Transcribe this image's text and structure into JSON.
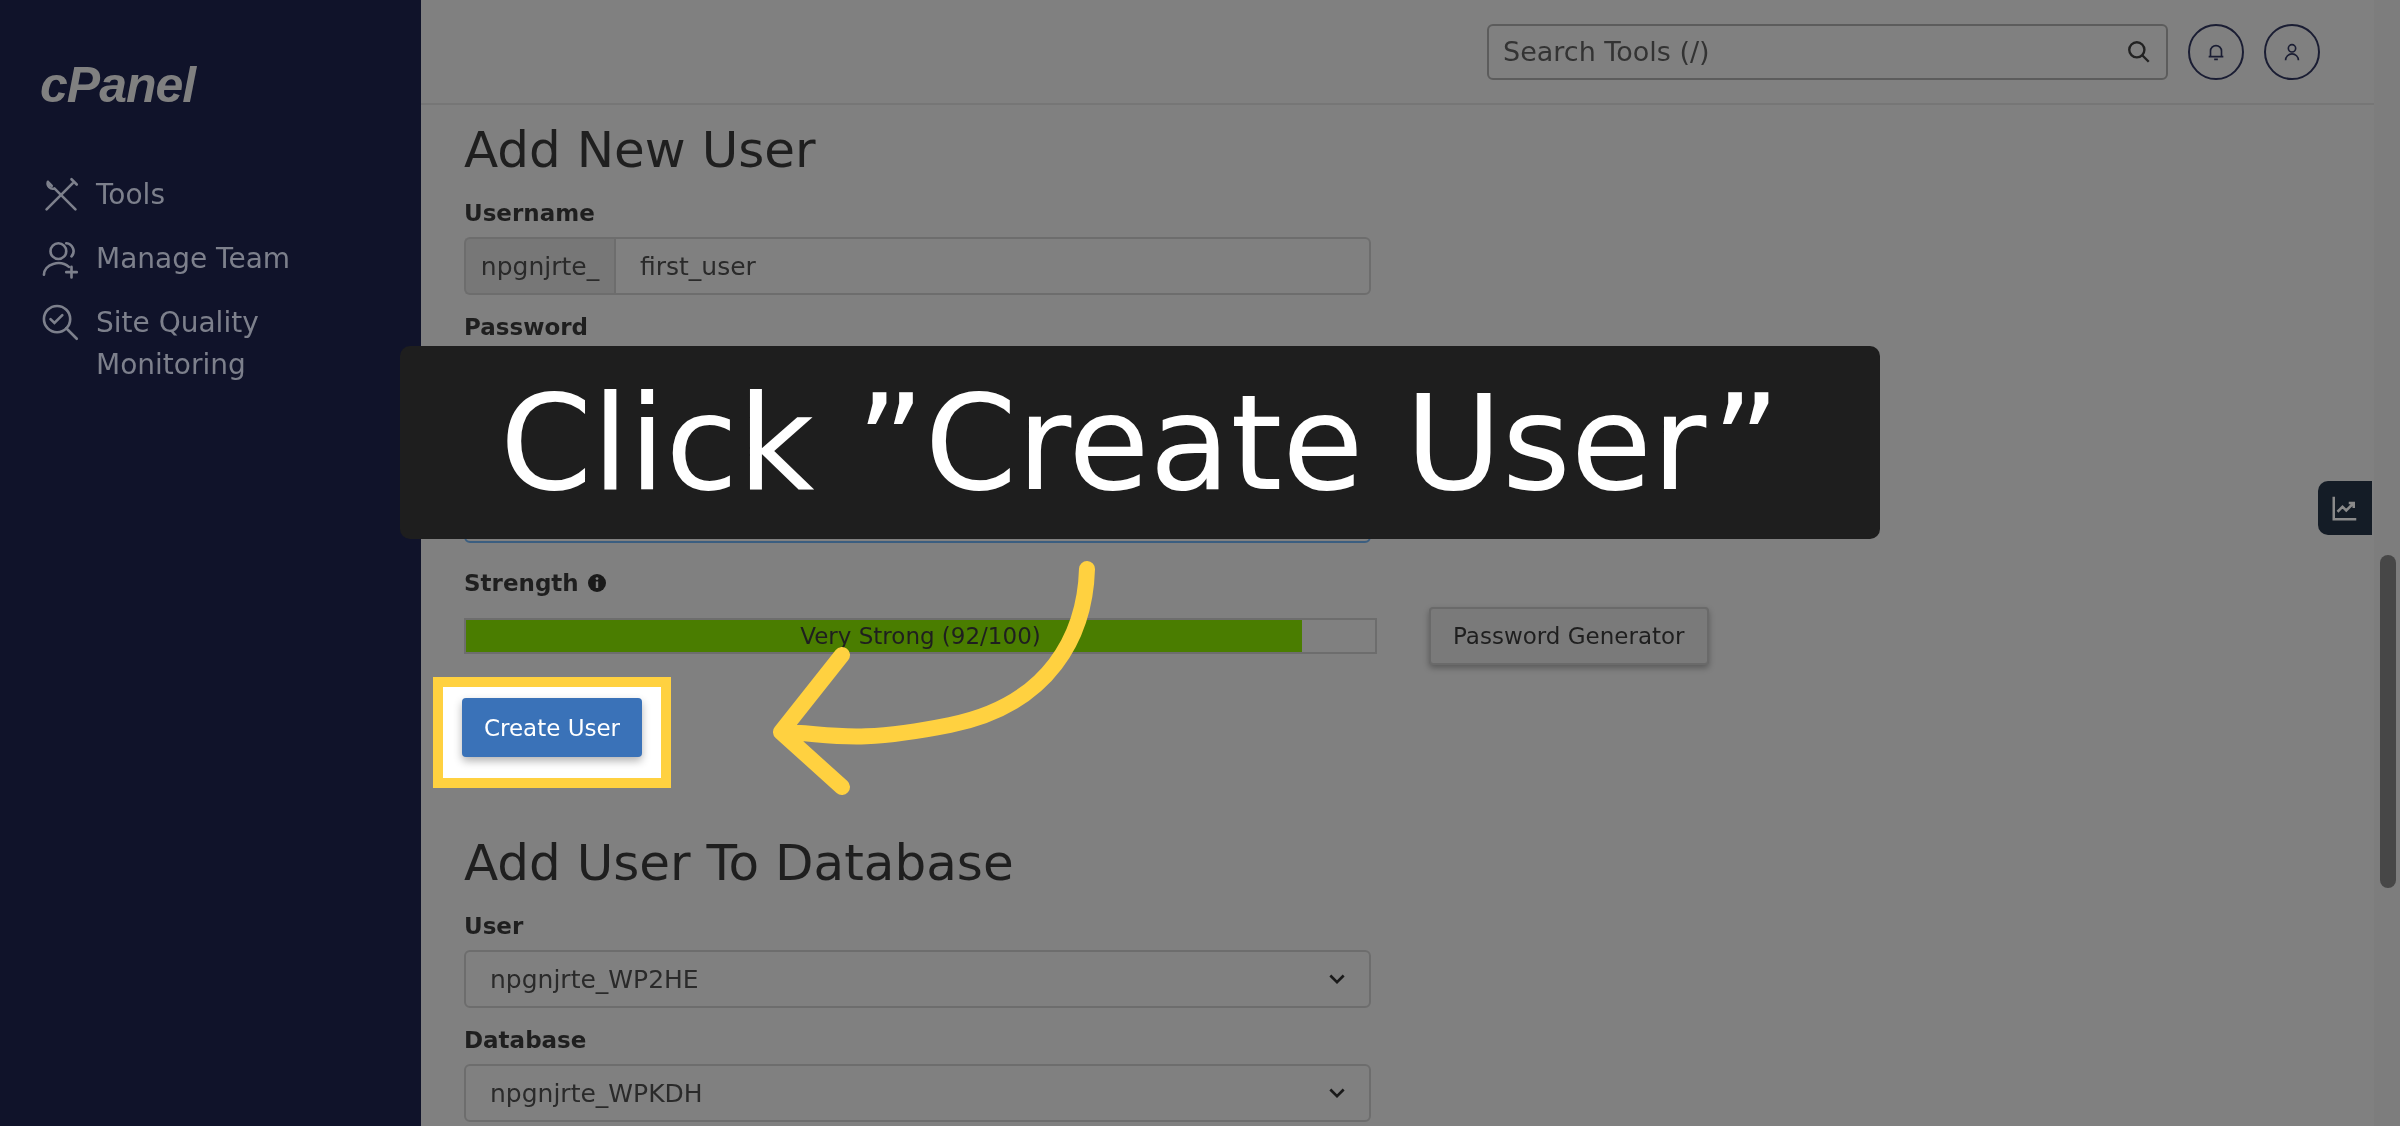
{
  "sidebar": {
    "logo": "cPanel",
    "items": [
      {
        "label": "Tools",
        "kind": "tools"
      },
      {
        "label": "Manage Team",
        "kind": "team"
      },
      {
        "label": "Site Quality Monitoring",
        "kind": "quality"
      }
    ]
  },
  "search": {
    "placeholder": "Search Tools (/)"
  },
  "add_user": {
    "title": "Add New User",
    "username_label": "Username",
    "username_prefix": "npgnjrte_",
    "username_value": "first_user",
    "password_label": "Password",
    "strength_label": "Strength",
    "strength": {
      "level": 0.92,
      "reading": "Very Strong (92/100)"
    },
    "generator_button": "Password Generator",
    "submit_button": "Create User"
  },
  "add_to_db": {
    "title": "Add User To Database",
    "user_label": "User",
    "user_value": "npgnjrte_WP2HE",
    "database_label": "Database",
    "database_value": "npgnjrte_WPKDH"
  },
  "callout": {
    "text": "Click ”Create User”"
  }
}
